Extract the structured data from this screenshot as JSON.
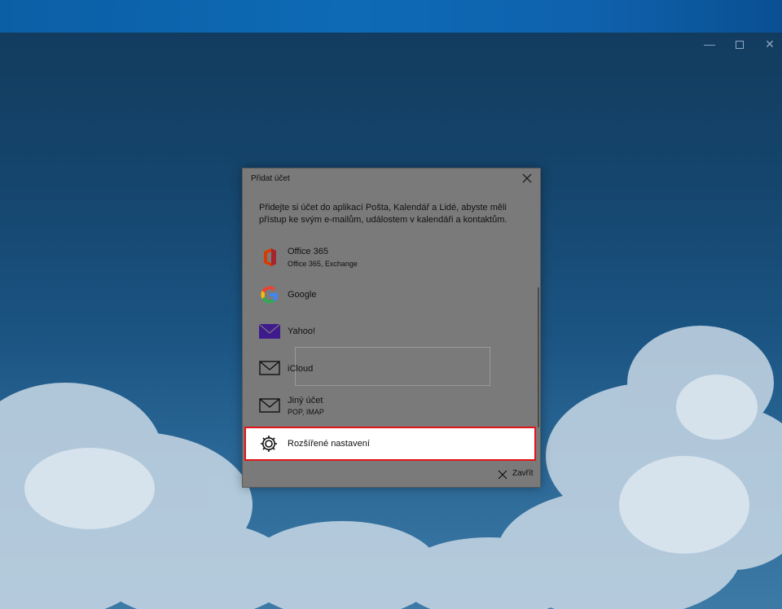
{
  "window": {
    "minimize_icon": "minimize-icon",
    "maximize_icon": "maximize-icon",
    "close_icon": "close-icon"
  },
  "dialog": {
    "title": "Přidat účet",
    "description": "Přidejte si účet do aplikací Pošta, Kalendář a Lidé, abyste měli přístup ke svým e-mailům, událostem v kalendáři a kontaktům.",
    "accounts": [
      {
        "label": "Office 365",
        "sub": "Office 365, Exchange",
        "icon": "office-icon"
      },
      {
        "label": "Google",
        "sub": "",
        "icon": "google-icon"
      },
      {
        "label": "Yahoo!",
        "sub": "",
        "icon": "yahoo-mail-icon"
      },
      {
        "label": "iCloud",
        "sub": "",
        "icon": "mail-envelope-icon"
      },
      {
        "label": "Jiný účet",
        "sub": "POP, IMAP",
        "icon": "mail-envelope-icon"
      },
      {
        "label": "Rozšířené nastavení",
        "sub": "",
        "icon": "gear-icon"
      }
    ],
    "close_label": "Zavřít"
  },
  "colors": {
    "highlight_border": "#e3151a",
    "topbar": "#0e6ab5",
    "overlay": "#7a7a7a"
  }
}
